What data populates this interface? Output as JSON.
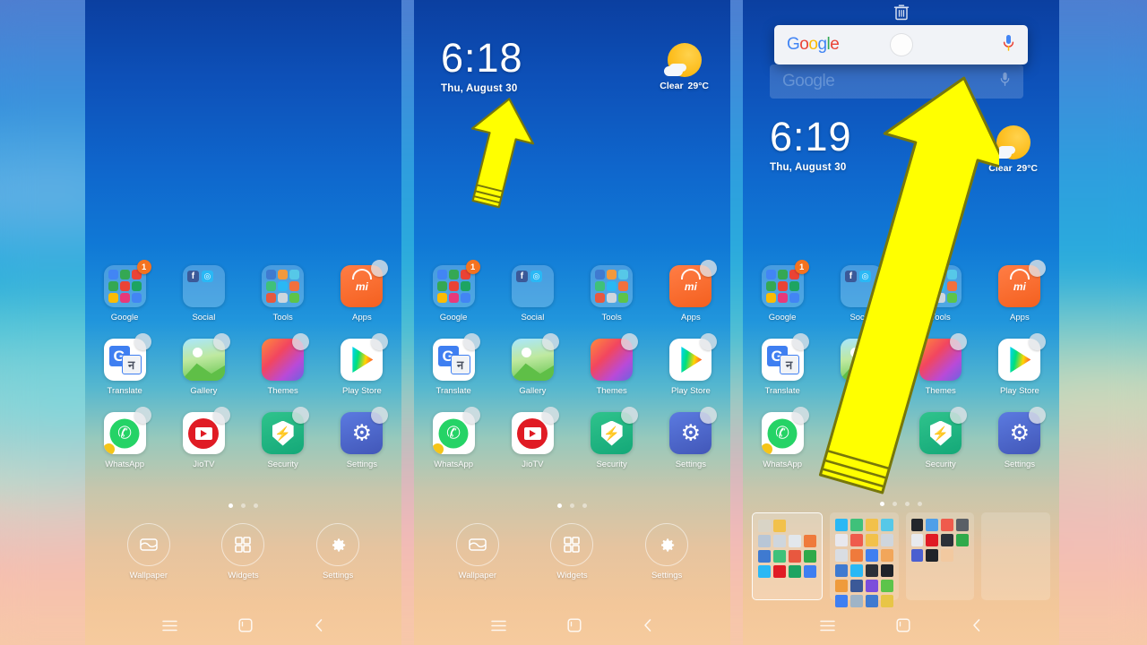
{
  "wallpaper": {
    "backdrop_desc": "blurred sky and clouds",
    "colors": {
      "top": "#0b3fa0",
      "mid": "#2196dc",
      "bottom": "#f6cb9e"
    }
  },
  "accent": {
    "badge": "#f4721f",
    "arrow": "#ffff00",
    "arrow_outline": "#6b6b00"
  },
  "panels": [
    {
      "id": "panel-1",
      "name": "home-screen-empty",
      "has_clock": false,
      "has_weather": false,
      "page_dots": {
        "count": 3,
        "active": 0
      }
    },
    {
      "id": "panel-2",
      "name": "home-screen-edit-mode",
      "has_clock": true,
      "has_weather": true,
      "clock": {
        "time": "6:18",
        "date": "Thu, August 30"
      },
      "weather": {
        "condition": "Clear",
        "temperature": "29°C",
        "icon": "sun-behind-cloud-icon"
      },
      "page_dots": {
        "count": 3,
        "active": 0
      }
    },
    {
      "id": "panel-3",
      "name": "home-screen-widget-drag",
      "has_clock": true,
      "has_weather": true,
      "clock": {
        "time": "6:19",
        "date": "Thu, August 30"
      },
      "weather": {
        "condition": "Clear",
        "temperature": "29°C",
        "icon": "sun-behind-cloud-icon"
      },
      "page_dots": {
        "count": 4,
        "active": 0
      }
    }
  ],
  "apps": {
    "rows": [
      [
        {
          "label": "Google",
          "type": "folder",
          "badge": "1",
          "bubble": false,
          "mini": [
            "#4285f4",
            "#34a853",
            "#ea4335",
            "#34a853",
            "#ea4335",
            "#1da462",
            "#fbbc05",
            "#e8397a",
            "#4285f4"
          ]
        },
        {
          "label": "Social",
          "type": "social-folder",
          "bubble": false
        },
        {
          "label": "Tools",
          "type": "folder",
          "bubble": false,
          "mini": [
            "#3f7ad0",
            "#f2993d",
            "#56c8e8",
            "#3fc17a",
            "#2ab8f5",
            "#f2703d",
            "#e8583f",
            "#cfd6dd",
            "#5dc44a"
          ]
        },
        {
          "label": "Apps",
          "type": "mi-store",
          "bubble": true
        }
      ],
      [
        {
          "label": "Translate",
          "type": "translate",
          "bubble": true
        },
        {
          "label": "Gallery",
          "type": "gallery",
          "bubble": true
        },
        {
          "label": "Themes",
          "type": "themes",
          "bubble": true
        },
        {
          "label": "Play Store",
          "type": "play-store",
          "bubble": true
        }
      ],
      [
        {
          "label": "WhatsApp",
          "type": "whatsapp",
          "bubble": true
        },
        {
          "label": "JioTV",
          "type": "jiotv",
          "bubble": true
        },
        {
          "label": "Security",
          "type": "security",
          "bubble": true
        },
        {
          "label": "Settings",
          "type": "settings",
          "bubble": true
        }
      ]
    ]
  },
  "edit_toolbar": {
    "items": [
      {
        "label": "Wallpaper",
        "icon": "wallpaper-icon"
      },
      {
        "label": "Widgets",
        "icon": "widgets-grid-icon"
      },
      {
        "label": "Settings",
        "icon": "gear-icon"
      }
    ]
  },
  "navbar": {
    "items": [
      {
        "name": "menu-button",
        "icon": "hamburger-menu-icon"
      },
      {
        "name": "home-button",
        "icon": "home-square-icon"
      },
      {
        "name": "back-button",
        "icon": "back-chevron-icon"
      }
    ]
  },
  "drag": {
    "trash_icon": "trash-can-icon",
    "widget": {
      "name": "google-search-widget",
      "logo_letters": [
        "G",
        "o",
        "o",
        "g",
        "l",
        "e"
      ],
      "mic_icon": "microphone-icon",
      "touch_point": "finger-touch-dot"
    },
    "ghost_label": "Google"
  },
  "page_thumbnails": [
    {
      "selected": true,
      "icons": [
        "#d9d4c6",
        "#f2c14a",
        "",
        "",
        "#b8c6d6",
        "#cfd6dd",
        "#e2e7ec",
        "#ef7a3c",
        "#3f7ad0",
        "#3fc17a",
        "#e8583f",
        "#2faa4a",
        "#2ab8f5",
        "#e01b24",
        "#1da462",
        "#3f7ff1"
      ]
    },
    {
      "selected": false,
      "icons": [
        "#2ab8f5",
        "#3fc17a",
        "#f2c14a",
        "#56c8e8",
        "#e8e8ee",
        "#ef5b4c",
        "#f2c14a",
        "#cfd6dd",
        "#d9dde3",
        "#ef7a3c",
        "#3f7ff1",
        "#f2a65a",
        "#3f7ad0",
        "#2ab8f5",
        "#2c3038",
        "#1f2329",
        "#ef9b3c",
        "#3b5998",
        "#7c4ddb",
        "#5dc44a",
        "#3f7ff1",
        "#9fb4c7",
        "#3f7ad0",
        "#e8c547"
      ]
    },
    {
      "selected": false,
      "icons": [
        "#23262b",
        "#4f9fe8",
        "#ef5b4c",
        "#5a5f66",
        "#e8eaee",
        "#e01b24",
        "#2c3038",
        "#2faa4a",
        "#4a5fd0",
        "#1f2329",
        "#f2c9a0"
      ]
    },
    {
      "selected": false,
      "icons": []
    }
  ],
  "arrows": [
    {
      "name": "instruction-arrow-small",
      "direction": "up"
    },
    {
      "name": "instruction-arrow-large",
      "direction": "up-right"
    }
  ]
}
